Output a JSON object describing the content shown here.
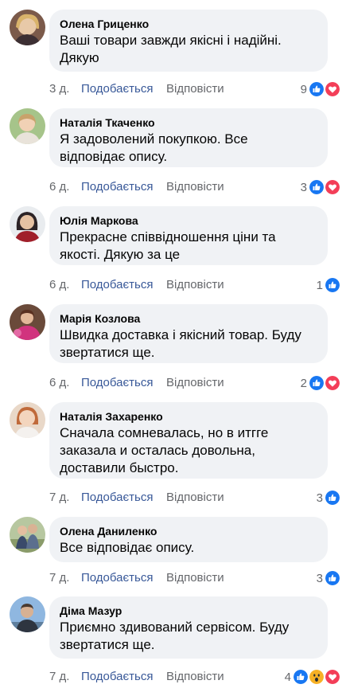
{
  "labels": {
    "like": "Подобається",
    "reply": "Відповісти"
  },
  "colors": {
    "bubble": "#f0f2f5",
    "like_blue": "#1877f2",
    "love_red": "#f33e58",
    "link": "#385898",
    "meta": "#65676b"
  },
  "comments": [
    {
      "author": "Олена Гриценко",
      "text": "Ваші товари завжди якісні і надійні. Дякую",
      "time": "3 д.",
      "reaction_count": "9",
      "reactions": [
        "like-icon",
        "love-icon"
      ],
      "avatar": "female-portrait-blonde"
    },
    {
      "author": "Наталія Ткаченко",
      "text": "Я задоволений покупкою. Все відповідає опису.",
      "time": "6 д.",
      "reaction_count": "3",
      "reactions": [
        "like-icon",
        "love-icon"
      ],
      "avatar": "female-portrait-outdoor"
    },
    {
      "author": "Юлія Маркова",
      "text": "Прекрасне співвідношення ціни та якості. Дякую за це",
      "time": "6 д.",
      "reaction_count": "1",
      "reactions": [
        "like-icon"
      ],
      "avatar": "female-portrait-dark-hair"
    },
    {
      "author": "Марія Козлова",
      "text": "Швидка доставка і якісний товар. Буду звертатися ще.",
      "time": "6 д.",
      "reaction_count": "2",
      "reactions": [
        "like-icon",
        "love-icon"
      ],
      "avatar": "female-portrait-pink"
    },
    {
      "author": "Наталія Захаренко",
      "text": "Сначала сомневалась, но в итгге заказала и осталась довольна, доставили быстро.",
      "time": "7 д.",
      "reaction_count": "3",
      "reactions": [
        "like-icon"
      ],
      "avatar": "female-portrait-red-hair"
    },
    {
      "author": "Олена Даниленко",
      "text": "Все відповідає опису.",
      "time": "7 д.",
      "reaction_count": "3",
      "reactions": [
        "like-icon"
      ],
      "avatar": "couple-portrait"
    },
    {
      "author": "Діма Мазур",
      "text": "Приємно здивований сервісом. Буду звертатися ще.",
      "time": "7 д.",
      "reaction_count": "4",
      "reactions": [
        "like-icon",
        "wow-icon",
        "love-icon"
      ],
      "avatar": "male-portrait-sky"
    }
  ]
}
